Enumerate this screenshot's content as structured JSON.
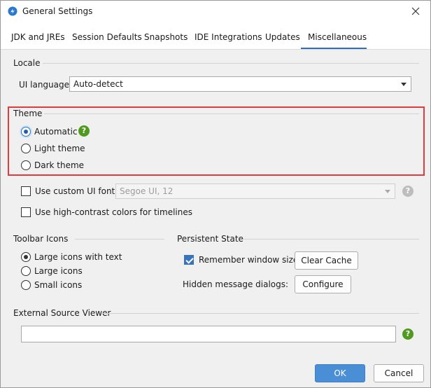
{
  "window": {
    "title": "General Settings"
  },
  "tabs": [
    {
      "label": "JDK and JREs"
    },
    {
      "label": "Session Defaults"
    },
    {
      "label": "Snapshots"
    },
    {
      "label": "IDE Integrations"
    },
    {
      "label": "Updates"
    },
    {
      "label": "Miscellaneous",
      "selected": true
    }
  ],
  "locale": {
    "section_title": "Locale",
    "ui_language_label": "UI language:",
    "ui_language_value": "Auto-detect"
  },
  "theme": {
    "section_title": "Theme",
    "options": [
      {
        "label": "Automatic",
        "checked": true
      },
      {
        "label": "Light theme",
        "checked": false
      },
      {
        "label": "Dark theme",
        "checked": false
      }
    ],
    "help_glyph": "?"
  },
  "font": {
    "custom_font_label": "Use custom UI font:",
    "custom_font_checked": false,
    "font_value": "Segoe UI, 12",
    "help_glyph": "?",
    "high_contrast_label": "Use high-contrast colors for timelines",
    "high_contrast_checked": false
  },
  "toolbar_icons": {
    "section_title": "Toolbar Icons",
    "options": [
      {
        "label": "Large icons with text",
        "checked": true
      },
      {
        "label": "Large icons",
        "checked": false
      },
      {
        "label": "Small icons",
        "checked": false
      }
    ]
  },
  "persistent_state": {
    "section_title": "Persistent State",
    "remember_label": "Remember window sizes",
    "remember_checked": true,
    "clear_cache_label": "Clear Cache",
    "hidden_dialogs_label": "Hidden message dialogs:",
    "configure_label": "Configure"
  },
  "external_viewer": {
    "section_title": "External Source Viewer",
    "value": "",
    "help_glyph": "?"
  },
  "buttons": {
    "ok": "OK",
    "cancel": "Cancel"
  },
  "icons": {
    "app": "app-logo-icon",
    "close": "close-icon",
    "help": "help-icon",
    "dropdown": "chevron-down-icon"
  },
  "colors": {
    "accent": "#2f6fb6",
    "primary_button": "#4a8fd6",
    "help_green": "#4f9a1f",
    "highlight_border": "#e03c3c"
  }
}
